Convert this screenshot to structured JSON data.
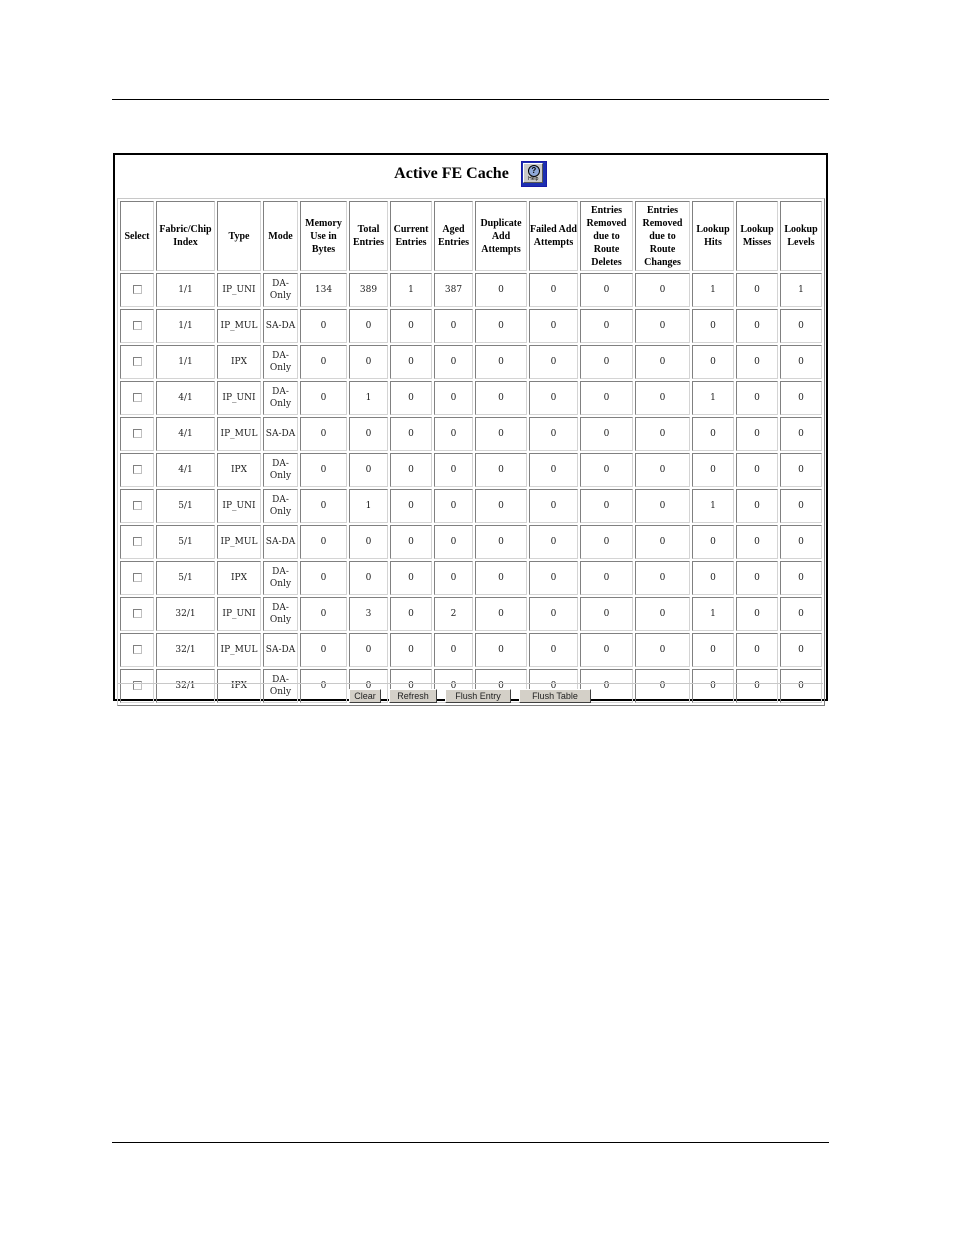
{
  "panel": {
    "title": "Active FE Cache",
    "help_icon": "help-icon",
    "help_icon_label": "Help"
  },
  "table": {
    "columns": [
      "Select",
      "Fabric/Chip Index",
      "Type",
      "Mode",
      "Memory Use in Bytes",
      "Total Entries",
      "Current Entries",
      "Aged Entries",
      "Duplicate Add Attempts",
      "Failed Add Attempts",
      "Entries Removed due to Route Deletes",
      "Entries Removed due to Route Changes",
      "Lookup Hits",
      "Lookup Misses",
      "Lookup Levels"
    ],
    "rows": [
      {
        "selected": false,
        "index": "1/1",
        "type": "IP_UNI",
        "mode": "DA-Only",
        "memory": "134",
        "total": "389",
        "current": "1",
        "aged": "387",
        "dup_add": "0",
        "failed_add": "0",
        "removed_deletes": "0",
        "removed_changes": "0",
        "hits": "1",
        "misses": "0",
        "levels": "1"
      },
      {
        "selected": false,
        "index": "1/1",
        "type": "IP_MUL",
        "mode": "SA-DA",
        "memory": "0",
        "total": "0",
        "current": "0",
        "aged": "0",
        "dup_add": "0",
        "failed_add": "0",
        "removed_deletes": "0",
        "removed_changes": "0",
        "hits": "0",
        "misses": "0",
        "levels": "0"
      },
      {
        "selected": false,
        "index": "1/1",
        "type": "IPX",
        "mode": "DA-Only",
        "memory": "0",
        "total": "0",
        "current": "0",
        "aged": "0",
        "dup_add": "0",
        "failed_add": "0",
        "removed_deletes": "0",
        "removed_changes": "0",
        "hits": "0",
        "misses": "0",
        "levels": "0"
      },
      {
        "selected": false,
        "index": "4/1",
        "type": "IP_UNI",
        "mode": "DA-Only",
        "memory": "0",
        "total": "1",
        "current": "0",
        "aged": "0",
        "dup_add": "0",
        "failed_add": "0",
        "removed_deletes": "0",
        "removed_changes": "0",
        "hits": "1",
        "misses": "0",
        "levels": "0"
      },
      {
        "selected": false,
        "index": "4/1",
        "type": "IP_MUL",
        "mode": "SA-DA",
        "memory": "0",
        "total": "0",
        "current": "0",
        "aged": "0",
        "dup_add": "0",
        "failed_add": "0",
        "removed_deletes": "0",
        "removed_changes": "0",
        "hits": "0",
        "misses": "0",
        "levels": "0"
      },
      {
        "selected": false,
        "index": "4/1",
        "type": "IPX",
        "mode": "DA-Only",
        "memory": "0",
        "total": "0",
        "current": "0",
        "aged": "0",
        "dup_add": "0",
        "failed_add": "0",
        "removed_deletes": "0",
        "removed_changes": "0",
        "hits": "0",
        "misses": "0",
        "levels": "0"
      },
      {
        "selected": false,
        "index": "5/1",
        "type": "IP_UNI",
        "mode": "DA-Only",
        "memory": "0",
        "total": "1",
        "current": "0",
        "aged": "0",
        "dup_add": "0",
        "failed_add": "0",
        "removed_deletes": "0",
        "removed_changes": "0",
        "hits": "1",
        "misses": "0",
        "levels": "0"
      },
      {
        "selected": false,
        "index": "5/1",
        "type": "IP_MUL",
        "mode": "SA-DA",
        "memory": "0",
        "total": "0",
        "current": "0",
        "aged": "0",
        "dup_add": "0",
        "failed_add": "0",
        "removed_deletes": "0",
        "removed_changes": "0",
        "hits": "0",
        "misses": "0",
        "levels": "0"
      },
      {
        "selected": false,
        "index": "5/1",
        "type": "IPX",
        "mode": "DA-Only",
        "memory": "0",
        "total": "0",
        "current": "0",
        "aged": "0",
        "dup_add": "0",
        "failed_add": "0",
        "removed_deletes": "0",
        "removed_changes": "0",
        "hits": "0",
        "misses": "0",
        "levels": "0"
      },
      {
        "selected": false,
        "index": "32/1",
        "type": "IP_UNI",
        "mode": "DA-Only",
        "memory": "0",
        "total": "3",
        "current": "0",
        "aged": "2",
        "dup_add": "0",
        "failed_add": "0",
        "removed_deletes": "0",
        "removed_changes": "0",
        "hits": "1",
        "misses": "0",
        "levels": "0"
      },
      {
        "selected": false,
        "index": "32/1",
        "type": "IP_MUL",
        "mode": "SA-DA",
        "memory": "0",
        "total": "0",
        "current": "0",
        "aged": "0",
        "dup_add": "0",
        "failed_add": "0",
        "removed_deletes": "0",
        "removed_changes": "0",
        "hits": "0",
        "misses": "0",
        "levels": "0"
      },
      {
        "selected": false,
        "index": "32/1",
        "type": "IPX",
        "mode": "DA-Only",
        "memory": "0",
        "total": "0",
        "current": "0",
        "aged": "0",
        "dup_add": "0",
        "failed_add": "0",
        "removed_deletes": "0",
        "removed_changes": "0",
        "hits": "0",
        "misses": "0",
        "levels": "0"
      }
    ]
  },
  "buttons": {
    "clear": "Clear",
    "refresh": "Refresh",
    "flush_entry": "Flush Entry",
    "flush_table": "Flush Table"
  }
}
